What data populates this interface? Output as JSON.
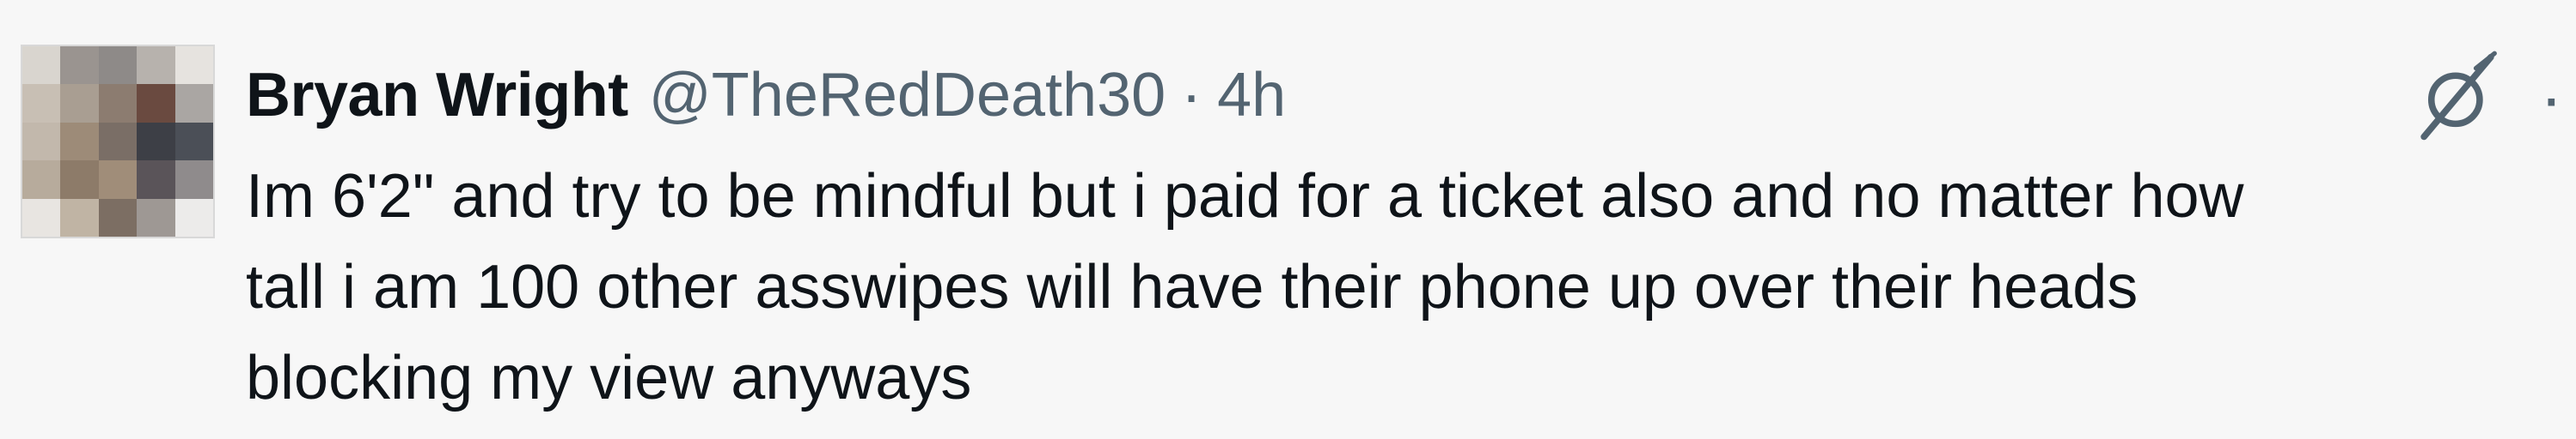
{
  "tweet": {
    "author_name": "Bryan Wright",
    "handle": "@TheRedDeath30",
    "separator": "·",
    "time": "4h",
    "text_lines": [
      "Im 6'2\" and try to be mindful but i paid for a ticket also and no matter how",
      "tall i am 100 other asswipes will have their phone up over their heads",
      "blocking my view anyways"
    ]
  },
  "icons": {
    "grok": "grok-icon",
    "more": "more-options-icon",
    "avatar": "avatar-pixelated"
  },
  "colors": {
    "background": "#f7f7f7",
    "text_primary": "#0f1419",
    "text_secondary": "#536471"
  },
  "avatar_pixels": [
    "#d9d5cf",
    "#9a9490",
    "#8e8a88",
    "#b7b2ad",
    "#e6e3df",
    "#c8bfb4",
    "#a99e92",
    "#8c7c70",
    "#6a4a40",
    "#aaa6a3",
    "#c2b8ac",
    "#9d8b78",
    "#7a6e66",
    "#3d3f46",
    "#4b4f57",
    "#b7ab9c",
    "#8d7b69",
    "#a08d79",
    "#5a5459",
    "#8f8b8c",
    "#e8e5e1",
    "#c0b4a4",
    "#7c6e63",
    "#9e9894",
    "#ecebea"
  ]
}
